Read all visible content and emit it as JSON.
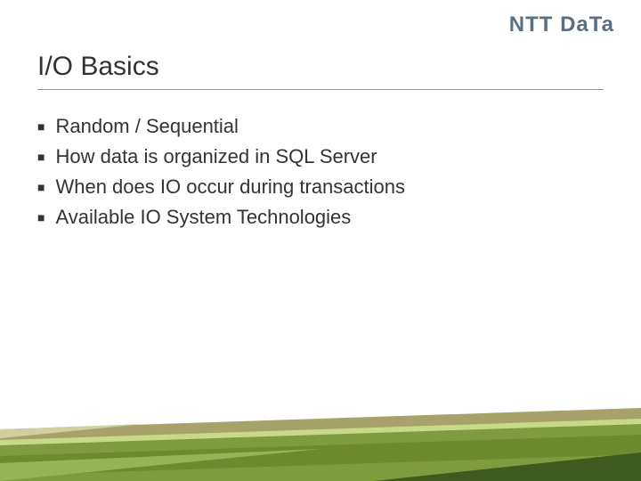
{
  "logo": {
    "text": "NTT DaTa"
  },
  "title": "I/O Basics",
  "bullets": [
    "Random / Sequential",
    "How data is organized in SQL Server",
    "When does IO occur during transactions",
    "Available IO System Technologies"
  ]
}
